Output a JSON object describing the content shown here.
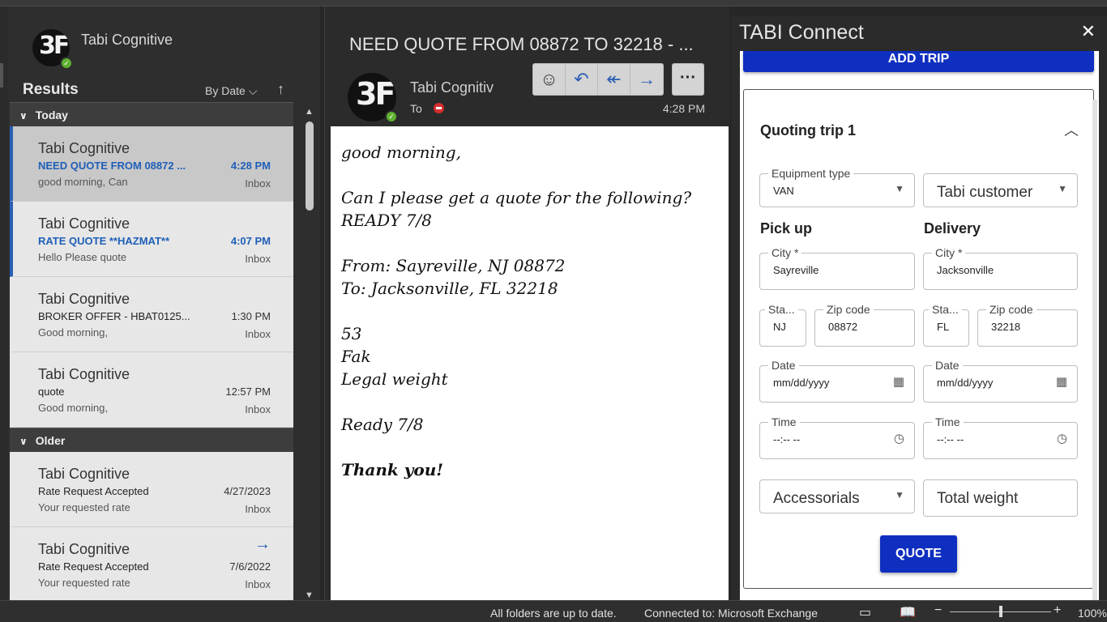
{
  "account": {
    "name": "Tabi Cognitive",
    "avatar_initials": "3F"
  },
  "list": {
    "title": "Results",
    "sort_label": "By Date",
    "groups": [
      {
        "label": "Today"
      },
      {
        "label": "Older"
      }
    ],
    "items": [
      {
        "from": "Tabi Cognitive",
        "subject": "NEED QUOTE FROM 08872 ...",
        "time": "4:28 PM",
        "preview": "good morning,  Can",
        "folder": "Inbox"
      },
      {
        "from": "Tabi Cognitive",
        "subject": "RATE QUOTE **HAZMAT**",
        "time": "4:07 PM",
        "preview": "Hello  Please quote",
        "folder": "Inbox"
      },
      {
        "from": "Tabi Cognitive",
        "subject": "BROKER OFFER - HBAT0125...",
        "time": "1:30 PM",
        "preview": "Good morning,",
        "folder": "Inbox"
      },
      {
        "from": "Tabi Cognitive",
        "subject": "quote",
        "time": "12:57 PM",
        "preview": "Good morning,",
        "folder": "Inbox"
      },
      {
        "from": "Tabi Cognitive",
        "subject": "Rate Request Accepted",
        "time": "4/27/2023",
        "preview": "Your requested rate",
        "folder": "Inbox"
      },
      {
        "from": "Tabi Cognitive",
        "subject": "Rate Request Accepted",
        "time": "7/6/2022",
        "preview": "Your requested rate",
        "folder": "Inbox"
      }
    ]
  },
  "reading": {
    "subject": "NEED QUOTE FROM 08872 TO 32218 - ...",
    "from": "Tabi Cognitiv",
    "to_label": "To",
    "time": "4:28 PM",
    "body": {
      "greeting": "good morning,",
      "ask": "Can I please get a quote for the following?",
      "ready1": "READY 7/8",
      "from_line": "From: Sayreville, NJ 08872",
      "to_line": "To: Jacksonville, FL 32218",
      "length": "53",
      "fak": "Fak",
      "weight": "Legal weight",
      "ready2": "Ready 7/8",
      "thanks": "Thank you!"
    }
  },
  "tabi": {
    "title": "TABI Connect",
    "add_trip": "ADD TRIP",
    "card_title": "Quoting trip 1",
    "equipment_label": "Equipment type",
    "equipment_value": "VAN",
    "customer": "Tabi customer",
    "pickup_title": "Pick up",
    "delivery_title": "Delivery",
    "city_label": "City *",
    "pickup_city": "Sayreville",
    "delivery_city": "Jacksonville",
    "state_label": "Sta...",
    "zip_label": "Zip code",
    "pickup_state": "NJ",
    "pickup_zip": "08872",
    "delivery_state": "FL",
    "delivery_zip": "32218",
    "date_label": "Date",
    "date_placeholder": "mm/dd/yyyy",
    "time_label": "Time",
    "time_placeholder": "--:-- --",
    "accessorials": "Accessorials",
    "total_weight": "Total weight",
    "quote_btn": "QUOTE"
  },
  "status": {
    "sync": "All folders are up to date.",
    "connection": "Connected to: Microsoft Exchange",
    "zoom": "100%",
    "zoom_level": 0.5
  }
}
